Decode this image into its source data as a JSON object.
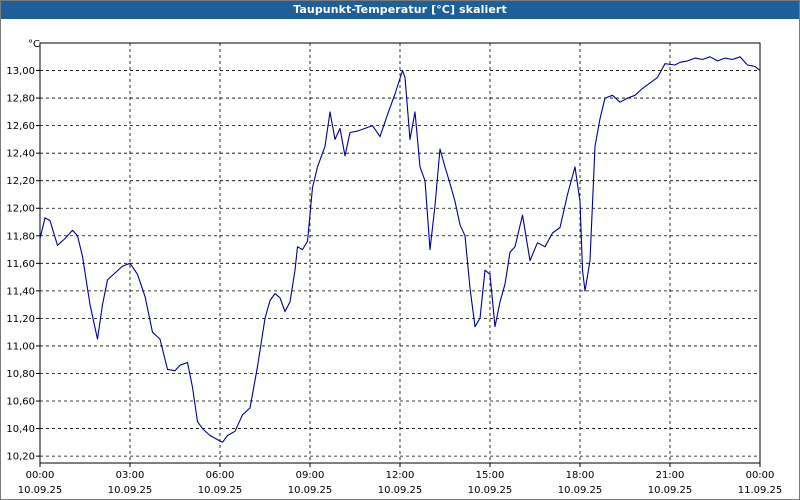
{
  "window": {
    "title": "Taupunkt-Temperatur [°C] skaliert"
  },
  "chart_data": {
    "type": "line",
    "title": "Taupunkt-Temperatur [°C] skaliert",
    "unit_label": "°C",
    "ylim": [
      10.15,
      13.2
    ],
    "y_ticks": [
      "13,00",
      "12,80",
      "12,60",
      "12,40",
      "12,20",
      "12,00",
      "11,80",
      "11,60",
      "11,40",
      "11,20",
      "11,00",
      "10,80",
      "10,60",
      "10,40",
      "10,20"
    ],
    "x_ticks": [
      {
        "time": "00:00",
        "date": "10.09.25"
      },
      {
        "time": "03:00",
        "date": "10.09.25"
      },
      {
        "time": "06:00",
        "date": "10.09.25"
      },
      {
        "time": "09:00",
        "date": "10.09.25"
      },
      {
        "time": "12:00",
        "date": "10.09.25"
      },
      {
        "time": "15:00",
        "date": "10.09.25"
      },
      {
        "time": "18:00",
        "date": "10.09.25"
      },
      {
        "time": "21:00",
        "date": "10.09.25"
      },
      {
        "time": "00:00",
        "date": "11.09.25"
      }
    ],
    "grid": true,
    "series": [
      {
        "color": "#000099",
        "x": [
          "00:00",
          "00:10",
          "00:20",
          "00:35",
          "00:50",
          "01:05",
          "01:15",
          "01:25",
          "01:40",
          "01:55",
          "02:05",
          "02:15",
          "02:30",
          "02:45",
          "03:00",
          "03:15",
          "03:30",
          "03:45",
          "04:00",
          "04:15",
          "04:30",
          "04:40",
          "04:55",
          "05:05",
          "05:15",
          "05:25",
          "05:40",
          "05:55",
          "06:05",
          "06:15",
          "06:30",
          "06:45",
          "07:00",
          "07:15",
          "07:30",
          "07:40",
          "07:50",
          "08:00",
          "08:10",
          "08:20",
          "08:30",
          "08:35",
          "08:45",
          "08:55",
          "09:05",
          "09:15",
          "09:30",
          "09:40",
          "09:50",
          "10:00",
          "10:10",
          "10:20",
          "10:35",
          "10:50",
          "11:05",
          "11:20",
          "11:35",
          "11:50",
          "12:05",
          "12:10",
          "12:20",
          "12:30",
          "12:40",
          "12:50",
          "13:00",
          "13:10",
          "13:20",
          "13:30",
          "13:40",
          "13:50",
          "14:00",
          "14:10",
          "14:20",
          "14:30",
          "14:40",
          "14:50",
          "15:00",
          "15:10",
          "15:20",
          "15:30",
          "15:40",
          "15:50",
          "16:05",
          "16:20",
          "16:35",
          "16:50",
          "17:05",
          "17:20",
          "17:35",
          "17:50",
          "18:00",
          "18:05",
          "18:10",
          "18:20",
          "18:30",
          "18:40",
          "18:50",
          "19:05",
          "19:20",
          "19:35",
          "19:50",
          "20:05",
          "20:20",
          "20:35",
          "20:50",
          "21:10",
          "21:20",
          "21:35",
          "21:50",
          "22:05",
          "22:20",
          "22:35",
          "22:50",
          "23:05",
          "23:20",
          "23:35",
          "23:50",
          "24:00"
        ],
        "y": [
          11.78,
          11.93,
          11.91,
          11.73,
          11.78,
          11.84,
          11.8,
          11.65,
          11.3,
          11.05,
          11.3,
          11.48,
          11.53,
          11.58,
          11.6,
          11.52,
          11.36,
          11.1,
          11.05,
          10.83,
          10.82,
          10.86,
          10.88,
          10.7,
          10.45,
          10.4,
          10.35,
          10.32,
          10.3,
          10.35,
          10.38,
          10.5,
          10.55,
          10.85,
          11.2,
          11.33,
          11.38,
          11.35,
          11.25,
          11.32,
          11.55,
          11.72,
          11.7,
          11.76,
          12.15,
          12.3,
          12.45,
          12.7,
          12.5,
          12.58,
          12.38,
          12.55,
          12.56,
          12.58,
          12.6,
          12.52,
          12.68,
          12.83,
          13.0,
          12.95,
          12.5,
          12.7,
          12.3,
          12.2,
          11.7,
          12.02,
          12.43,
          12.3,
          12.18,
          12.05,
          11.88,
          11.8,
          11.42,
          11.14,
          11.2,
          11.55,
          11.52,
          11.14,
          11.32,
          11.45,
          11.68,
          11.72,
          11.95,
          11.62,
          11.75,
          11.72,
          11.82,
          11.86,
          12.1,
          12.3,
          12.05,
          11.55,
          11.4,
          11.62,
          12.45,
          12.65,
          12.8,
          12.82,
          12.77,
          12.8,
          12.82,
          12.87,
          12.91,
          12.95,
          13.05,
          13.04,
          13.06,
          13.07,
          13.09,
          13.08,
          13.1,
          13.07,
          13.09,
          13.08,
          13.1,
          13.04,
          13.03,
          13.0
        ]
      }
    ]
  }
}
